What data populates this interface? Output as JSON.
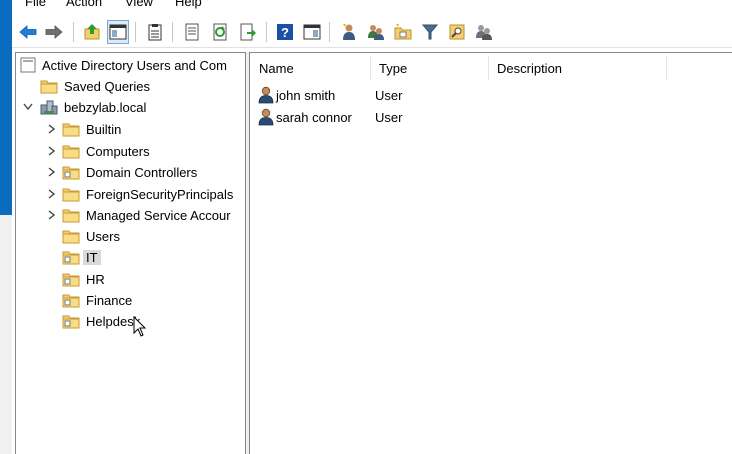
{
  "menu": {
    "file": "File",
    "action": "Action",
    "view": "View",
    "help": "Help"
  },
  "toolbar": {
    "buttons": [
      {
        "icon": "back-arrow-icon"
      },
      {
        "icon": "forward-arrow-icon"
      },
      {
        "icon": "up-one-level-icon"
      },
      {
        "icon": "show-hide-console-tree-icon"
      },
      {
        "icon": "properties-clipboard-icon"
      },
      {
        "icon": "export-list-icon"
      },
      {
        "icon": "refresh-icon"
      },
      {
        "icon": "export-arrow-icon"
      },
      {
        "icon": "help-icon"
      },
      {
        "icon": "action-pane-icon"
      },
      {
        "icon": "new-user-icon"
      },
      {
        "icon": "new-group-icon"
      },
      {
        "icon": "new-ou-icon"
      },
      {
        "icon": "filter-icon"
      },
      {
        "icon": "find-icon"
      },
      {
        "icon": "add-to-group-icon"
      }
    ]
  },
  "tree": {
    "root": "Active Directory Users and Com",
    "saved_queries": "Saved Queries",
    "domain": "bebzylab.local",
    "children": [
      {
        "label": "Builtin",
        "type": "container",
        "expandable": true
      },
      {
        "label": "Computers",
        "type": "container",
        "expandable": true
      },
      {
        "label": "Domain Controllers",
        "type": "ou",
        "expandable": true
      },
      {
        "label": "ForeignSecurityPrincipals",
        "type": "container",
        "expandable": true
      },
      {
        "label": "Managed Service Accour",
        "type": "container",
        "expandable": true
      },
      {
        "label": "Users",
        "type": "container",
        "expandable": false
      },
      {
        "label": "IT",
        "type": "ou",
        "expandable": false,
        "selected": true
      },
      {
        "label": "HR",
        "type": "ou",
        "expandable": false
      },
      {
        "label": "Finance",
        "type": "ou",
        "expandable": false
      },
      {
        "label": "Helpdesk",
        "type": "ou",
        "expandable": false
      }
    ]
  },
  "list": {
    "columns": [
      "Name",
      "Type",
      "Description"
    ],
    "rows": [
      {
        "name": "john smith",
        "type": "User",
        "description": ""
      },
      {
        "name": "sarah connor",
        "type": "User",
        "description": ""
      }
    ]
  },
  "colors": {
    "selection": "#d9d9d9",
    "accent": "#0a6cbf",
    "folder": "#f5cf6b"
  }
}
